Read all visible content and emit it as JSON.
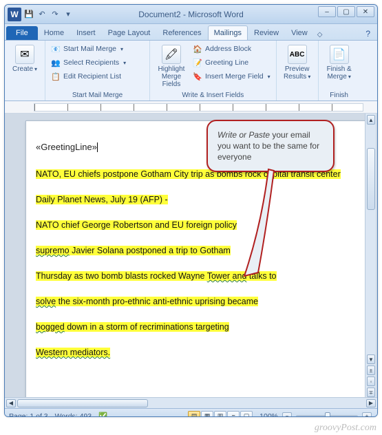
{
  "title": "Document2 - Microsoft Word",
  "qat": {
    "save": "💾",
    "undo": "↶",
    "redo": "↷"
  },
  "tabs": {
    "file": "File",
    "items": [
      "Home",
      "Insert",
      "Page Layout",
      "References",
      "Mailings",
      "Review",
      "View"
    ],
    "active": "Mailings"
  },
  "ribbon": {
    "create": {
      "label": "Create",
      "icon": "✉"
    },
    "start_group_label": "Start Mail Merge",
    "start_items": {
      "start": "Start Mail Merge",
      "select": "Select Recipients",
      "edit": "Edit Recipient List"
    },
    "highlight": {
      "label1": "Highlight",
      "label2": "Merge Fields",
      "icon": "🖍"
    },
    "write_group_label": "Write & Insert Fields",
    "write_items": {
      "addr": "Address Block",
      "greet": "Greeting Line",
      "insert": "Insert Merge Field"
    },
    "preview": {
      "label1": "Preview",
      "label2": "Results",
      "icon": "ABC"
    },
    "preview_group_label": "",
    "finish": {
      "label1": "Finish &",
      "label2": "Merge",
      "icon": "📄"
    },
    "finish_group_label": "Finish"
  },
  "callout": {
    "line1": "Write or Paste",
    "line2": " your email you want to be the same for everyone"
  },
  "doc": {
    "greeting": "«GreetingLine»",
    "p1": "NATO, EU chiefs postpone Gotham City trip as bombs rock capital transit center",
    "p2": "Daily Planet News, July 19 (AFP) -",
    "p3a": "NATO chief George Robertson and EU foreign policy",
    "p4_wavy": "supremo",
    "p4": " Javier Solana postponed a trip to Gotham",
    "p5a": "Thursday as two bomb blasts rocked Wayne ",
    "p5_wavy": "Tower and",
    "p5b": " talks to",
    "p6_wavy": "solve",
    "p6": " the six-month pro-ethnic anti-ethnic uprising became",
    "p7_wavy": "bogged",
    "p7": " down in a storm of recriminations targeting",
    "p8_wavy": "Western mediators."
  },
  "status": {
    "page": "Page: 1 of 3",
    "words": "Words: 493",
    "zoom": "100%"
  },
  "watermark": "groovyPost.com"
}
